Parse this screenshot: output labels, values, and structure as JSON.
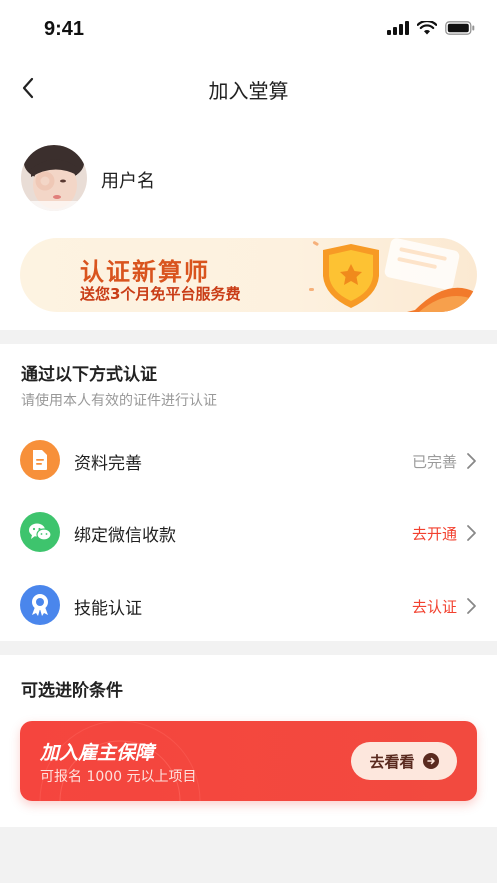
{
  "status_bar": {
    "time": "9:41"
  },
  "nav": {
    "title": "加入堂算"
  },
  "user": {
    "name": "用户名"
  },
  "promo": {
    "title": "认证新算师",
    "subtitle": "送您3个月免平台服务费"
  },
  "certify": {
    "title": "通过以下方式认证",
    "subtitle": "请使用本人有效的证件进行认证",
    "items": [
      {
        "label": "资料完善",
        "status": "已完善",
        "status_color": "#9a9a9a",
        "icon": "document-icon",
        "icon_color": "#f7903a"
      },
      {
        "label": "绑定微信收款",
        "status": "去开通",
        "status_color": "#f2412f",
        "icon": "wechat-icon",
        "icon_color": "#3ec46d"
      },
      {
        "label": "技能认证",
        "status": "去认证",
        "status_color": "#f2412f",
        "icon": "badge-icon",
        "icon_color": "#4a86ec"
      }
    ]
  },
  "advanced": {
    "title": "可选进阶条件",
    "card_title": "加入雇主保障",
    "card_subtitle": "可报名 1000 元以上项目",
    "button_label": "去看看"
  }
}
